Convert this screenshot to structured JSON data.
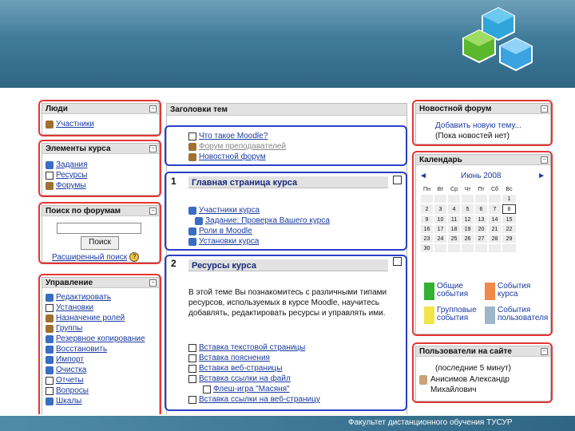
{
  "blocks": {
    "people": {
      "title": "Люди",
      "items": [
        "Участники"
      ]
    },
    "elements": {
      "title": "Элементы курса",
      "items": [
        "Задания",
        "Ресурсы",
        "Форумы"
      ]
    },
    "search": {
      "title": "Поиск по форумам",
      "button": "Поиск",
      "advanced": "Расширенный поиск"
    },
    "admin": {
      "title": "Управление",
      "items": [
        "Редактировать",
        "Установки",
        "Назначение ролей",
        "Группы",
        "Резервное копирование",
        "Восстановить",
        "Импорт",
        "Очистка",
        "Отчеты",
        "Вопросы",
        "Шкалы"
      ]
    },
    "news": {
      "title": "Новостной форум",
      "add": "Добавить новую тему...",
      "none": "(Пока новостей нет)"
    },
    "calendar": {
      "title": "Календарь",
      "month": "Июнь 2008",
      "prev": "◄",
      "next": "►",
      "days": [
        "Пн",
        "Вт",
        "Ср",
        "Чт",
        "Пт",
        "Сб",
        "Вс"
      ],
      "weeks": [
        [
          "",
          "",
          "",
          "",
          "",
          "",
          "1"
        ],
        [
          "2",
          "3",
          "4",
          "5",
          "6",
          "7",
          "8"
        ],
        [
          "9",
          "10",
          "11",
          "12",
          "13",
          "14",
          "15"
        ],
        [
          "16",
          "17",
          "18",
          "19",
          "20",
          "21",
          "22"
        ],
        [
          "23",
          "24",
          "25",
          "26",
          "27",
          "28",
          "29"
        ],
        [
          "30",
          "",
          "",
          "",
          "",
          "",
          ""
        ]
      ],
      "today": "8",
      "events": {
        "global": "Общие события",
        "course": "События курса",
        "group": "Групповые события",
        "user": "События пользователя"
      }
    },
    "online": {
      "title": "Пользователи на сайте",
      "period": "(последние 5 минут)",
      "user": "Анисимов Александр Михайлович"
    }
  },
  "center": {
    "title": "Заголовки тем",
    "top_items": [
      "Что такое Moodle?",
      "Форум преподавателей",
      "Новостной форум"
    ],
    "section1": {
      "num": "1",
      "title": "Главная страница курса",
      "items": [
        "Участники курса",
        "Задание: Проверка Вашего курса",
        "Роли в Moodle",
        "Установки курса"
      ]
    },
    "section2": {
      "num": "2",
      "title": "Ресурсы курса",
      "desc": "В этой теме Вы познакомитесь с различными типами ресурсов, используемых в курсе Moodle, научитесь добавлять, редактировать ресурсы и управлять ими.",
      "items": [
        "Вставка текстовой страницы",
        "Вставка пояснения",
        "Вставка веб-страницы",
        "Вставка ссылки на файл",
        "Флеш-игра \"Масяня\"",
        "Вставка ссылки на веб-страницу"
      ]
    }
  },
  "footer": "Факультет дистанционного обучения ТУСУР",
  "colors": {
    "highlight_red": "#e53535",
    "highlight_blue": "#2a3fc7",
    "header_band": "#3d7796"
  }
}
